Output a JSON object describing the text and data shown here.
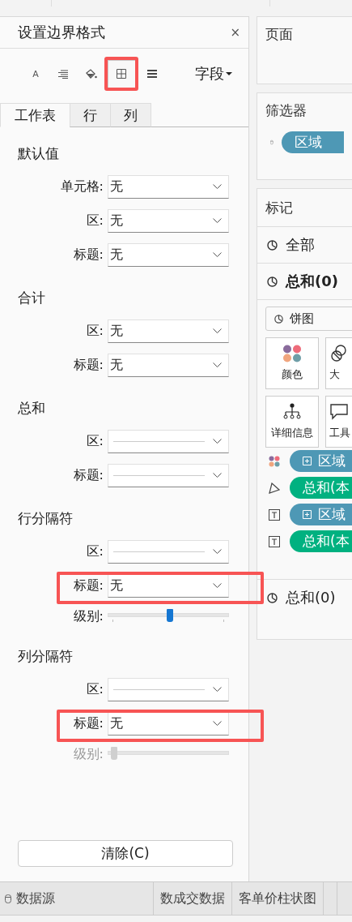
{
  "format_panel": {
    "title": "设置边界格式",
    "close": "×",
    "tools": [
      {
        "kind": "font",
        "glyph": "A",
        "selected": false,
        "highlighted": false
      },
      {
        "kind": "align",
        "selected": false,
        "highlighted": false
      },
      {
        "kind": "shading",
        "selected": false,
        "highlighted": false
      },
      {
        "kind": "borders",
        "selected": true,
        "highlighted": true
      },
      {
        "kind": "lines",
        "selected": false,
        "highlighted": false
      }
    ],
    "field_menu": "字段",
    "tabs": [
      {
        "label": "工作表",
        "selected": true
      },
      {
        "label": "行",
        "selected": false
      },
      {
        "label": "列",
        "selected": false
      }
    ],
    "sections": [
      {
        "title": "默认值",
        "rows": [
          {
            "kind": "dropdown",
            "label": "单元格:",
            "value": "无",
            "highlighted": false
          },
          {
            "kind": "dropdown",
            "label": "区:",
            "value": "无",
            "highlighted": false
          },
          {
            "kind": "dropdown",
            "label": "标题:",
            "value": "无",
            "highlighted": false
          }
        ]
      },
      {
        "title": "合计",
        "rows": [
          {
            "kind": "dropdown",
            "label": "区:",
            "value": "无",
            "highlighted": false
          },
          {
            "kind": "dropdown",
            "label": "标题:",
            "value": "无",
            "highlighted": false
          }
        ]
      },
      {
        "title": "总和",
        "rows": [
          {
            "kind": "line-dropdown",
            "label": "区:",
            "highlighted": false
          },
          {
            "kind": "line-dropdown",
            "label": "标题:",
            "highlighted": false
          }
        ]
      },
      {
        "title": "行分隔符",
        "rows": [
          {
            "kind": "line-dropdown",
            "label": "区:",
            "highlighted": false
          },
          {
            "kind": "dropdown",
            "label": "标题:",
            "value": "无",
            "highlighted": true
          },
          {
            "kind": "slider",
            "label": "级别:",
            "level": 0.5,
            "disabled": false
          }
        ]
      },
      {
        "title": "列分隔符",
        "rows": [
          {
            "kind": "line-dropdown",
            "label": "区:",
            "highlighted": false
          },
          {
            "kind": "dropdown",
            "label": "标题:",
            "value": "无",
            "highlighted": true
          },
          {
            "kind": "slider",
            "label": "级别:",
            "level": 0,
            "disabled": true
          }
        ]
      }
    ],
    "clear_button": "清除(C)"
  },
  "pages_card": {
    "title": "页面"
  },
  "filters_card": {
    "title": "筛选器",
    "pills": [
      {
        "label": "区域",
        "color": "#4e98b5"
      }
    ]
  },
  "marks_card": {
    "title": "标记",
    "layers": [
      {
        "label": "全部",
        "bold": false
      },
      {
        "label": "总和(0)",
        "bold": true
      }
    ],
    "mark_type": "饼图",
    "buttons": [
      {
        "kind": "color",
        "label": "颜色"
      },
      {
        "kind": "size",
        "label": "大"
      },
      {
        "kind": "detail",
        "label": "详细信息"
      },
      {
        "kind": "tooltip",
        "label": "工具"
      }
    ],
    "shelf": [
      {
        "kind": "color",
        "label": "区域",
        "expandable": true,
        "color": "#4e98b5"
      },
      {
        "kind": "angle",
        "label": "总和(本",
        "expandable": false,
        "color": "#00b180"
      },
      {
        "kind": "label",
        "label": "区域",
        "expandable": true,
        "color": "#4e98b5"
      },
      {
        "kind": "label",
        "label": "总和(本",
        "expandable": false,
        "color": "#00b180"
      }
    ],
    "footer_layer": {
      "label": "总和(0)"
    }
  },
  "sheet_tabs": [
    {
      "kind": "source",
      "label": "数据源"
    },
    {
      "kind": "sheet",
      "label": "数成交数据"
    },
    {
      "kind": "sheet",
      "label": "客单价柱状图"
    },
    {
      "kind": "sheet"
    }
  ]
}
